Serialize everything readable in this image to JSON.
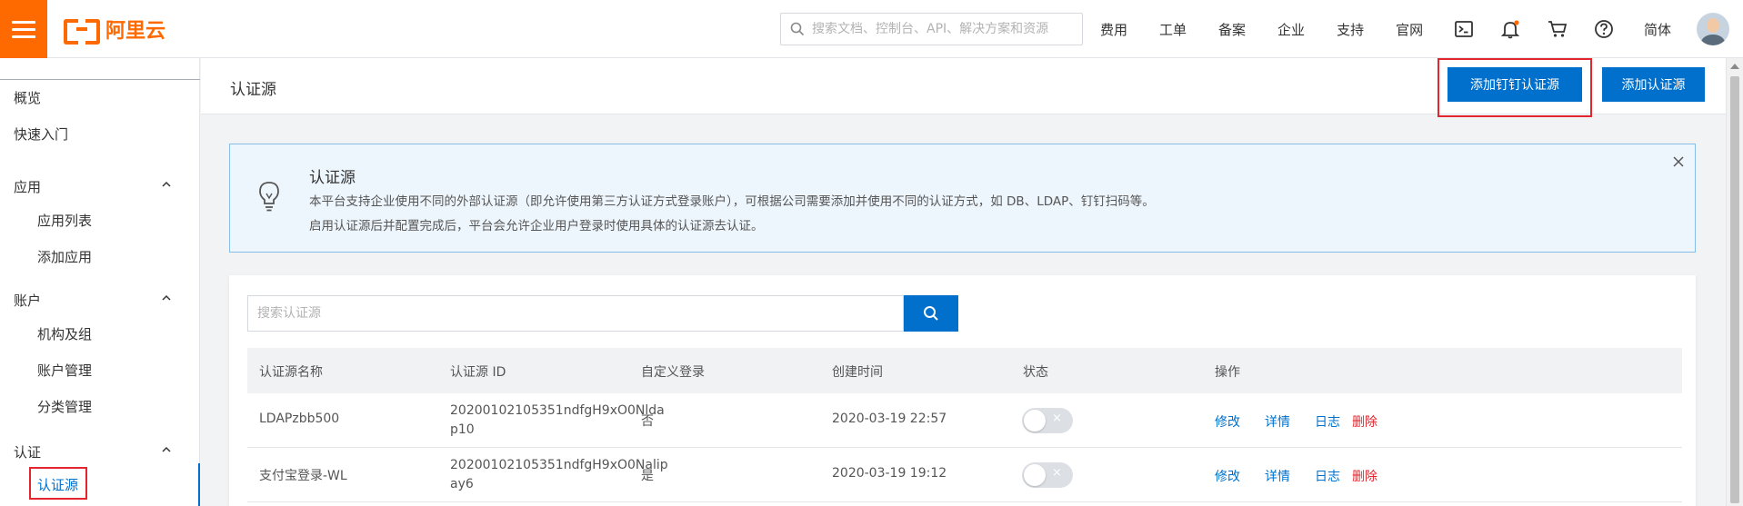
{
  "brand": {
    "logo_text": "阿里云",
    "color": "#ff6a00"
  },
  "topbar": {
    "search_placeholder": "搜索文档、控制台、API、解决方案和资源",
    "nav": [
      "费用",
      "工单",
      "备案",
      "企业",
      "支持",
      "官网"
    ],
    "language": "简体",
    "icons": [
      "terminal-icon",
      "bell-icon",
      "cart-icon",
      "help-icon"
    ]
  },
  "sidebar": {
    "items": [
      {
        "label": "概览"
      },
      {
        "label": "快速入门"
      }
    ],
    "groups": [
      {
        "label": "应用",
        "children": [
          "应用列表",
          "添加应用"
        ]
      },
      {
        "label": "账户",
        "children": [
          "机构及组",
          "账户管理",
          "分类管理"
        ]
      },
      {
        "label": "认证",
        "children": [
          "认证源"
        ]
      }
    ],
    "active": "认证源"
  },
  "page": {
    "title": "认证源",
    "btn_add_dingtalk": "添加钉钉认证源",
    "btn_add_source": "添加认证源"
  },
  "notice": {
    "title": "认证源",
    "line1": "本平台支持企业使用不同的外部认证源（即允许使用第三方认证方式登录账户），可根据公司需要添加并使用不同的认证方式，如 DB、LDAP、钉钉扫码等。",
    "line2": "启用认证源后并配置完成后，平台会允许企业用户登录时使用具体的认证源去认证。"
  },
  "search": {
    "placeholder": "搜索认证源"
  },
  "table": {
    "headers": [
      "认证源名称",
      "认证源 ID",
      "自定义登录",
      "创建时间",
      "状态",
      "操作"
    ],
    "rows": [
      {
        "name": "LDAPzbb500",
        "id": "20200102105351ndfgH9xO0Nldap10",
        "custom_login": "否",
        "created": "2020-03-19 22:57",
        "status_on": false
      },
      {
        "name": "支付宝登录-WL",
        "id": "20200102105351ndfgH9xO0Nalipay6",
        "custom_login": "是",
        "created": "2020-03-19 19:12",
        "status_on": false
      }
    ],
    "actions": {
      "edit": "修改",
      "detail": "详情",
      "log": "日志",
      "delete": "删除"
    },
    "toggle_off_glyph": "×"
  },
  "colors": {
    "primary": "#0070cc",
    "danger": "#e3262e",
    "notice_bg": "#eef6fd"
  }
}
